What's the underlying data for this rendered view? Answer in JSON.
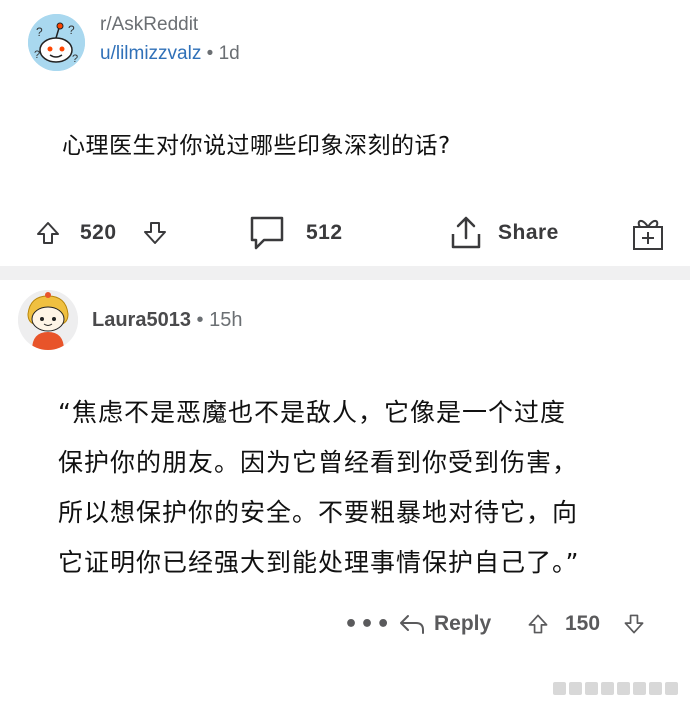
{
  "post": {
    "subreddit": "r/AskReddit",
    "author": "u/lilmizzvalz",
    "separator": "•",
    "age": "1d",
    "title": "心理医生对你说过哪些印象深刻的话?",
    "upvotes": "520",
    "comments": "512",
    "share_label": "Share"
  },
  "comment": {
    "author": "Laura5013",
    "separator": "•",
    "age": "15h",
    "lines": [
      "“焦虑不是恶魔也不是敌人，它像是一个过度",
      "保护你的朋友。因为它曾经看到你受到伤害，",
      "所以想保护你的安全。不要粗暴地对待它，向",
      "它证明你已经强大到能处理事情保护自己了。”"
    ],
    "more_label": "•••",
    "reply_label": "Reply",
    "upvotes": "150"
  },
  "colors": {
    "accent_link": "#2f70b8",
    "divider": "#f0f0f1",
    "icon_gray": "#5a5a5c"
  },
  "icons": {
    "upvote": "arrow-up-icon",
    "downvote": "arrow-down-icon",
    "comment": "speech-bubble-icon",
    "share": "share-icon",
    "award": "gift-icon",
    "reply": "reply-arrow-icon",
    "more": "more-dots-icon"
  }
}
